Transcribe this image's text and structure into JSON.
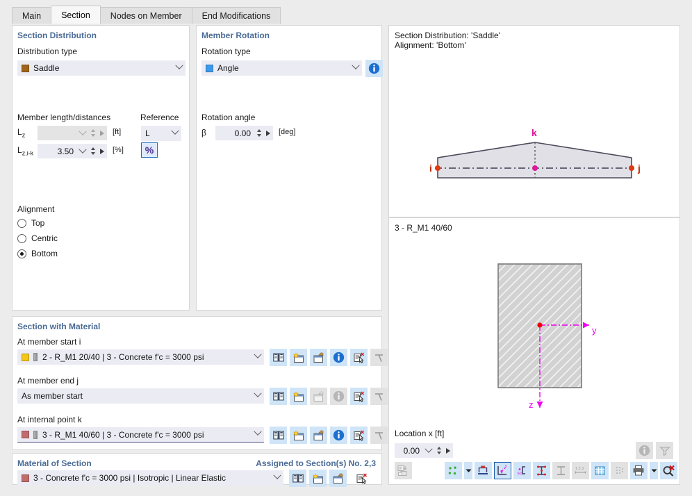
{
  "tabs": [
    {
      "label": "Main",
      "active": false
    },
    {
      "label": "Section",
      "active": true
    },
    {
      "label": "Nodes on Member",
      "active": false
    },
    {
      "label": "End Modifications",
      "active": false
    }
  ],
  "section_distribution": {
    "title": "Section Distribution",
    "distribution_type_label": "Distribution type",
    "distribution_type_value": "Saddle",
    "distribution_type_color": "#a0651a",
    "member_length_label": "Member length/distances",
    "reference_label": "Reference",
    "rows": [
      {
        "symbol": "L",
        "sub": "z",
        "value": "",
        "unit": "[ft]",
        "disabled": true
      },
      {
        "symbol": "L",
        "sub": "z,i-k",
        "value": "3.50",
        "unit": "[%]",
        "disabled": false
      }
    ],
    "reference_value": "L",
    "percent_button_label": "%",
    "alignment_label": "Alignment",
    "alignment_options": [
      {
        "label": "Top",
        "checked": false
      },
      {
        "label": "Centric",
        "checked": false
      },
      {
        "label": "Bottom",
        "checked": true
      }
    ]
  },
  "member_rotation": {
    "title": "Member Rotation",
    "rotation_type_label": "Rotation type",
    "rotation_type_value": "Angle",
    "rotation_type_color": "#3b9aec",
    "rotation_angle_label": "Rotation angle",
    "beta_symbol": "β",
    "beta_value": "0.00",
    "beta_unit": "[deg]"
  },
  "section_with_material": {
    "title": "Section with Material",
    "fields": [
      {
        "label": "At member start i",
        "value": "2 - R_M1 20/40 | 3 - Concrete f'c = 3000 psi",
        "color": "#f5c518",
        "has_swatch": true,
        "underline": false,
        "buttons": [
          "library-icon",
          "new-section-icon",
          "edit-section-icon",
          "info-icon",
          "select-in-model-icon",
          "pick-icon"
        ],
        "button_states": [
          true,
          true,
          true,
          true,
          true,
          false
        ]
      },
      {
        "label": "At member end j",
        "value": "As member start",
        "color": "",
        "has_swatch": false,
        "underline": false,
        "buttons": [
          "library-icon",
          "new-section-icon",
          "edit-section-icon",
          "info-icon",
          "select-in-model-icon",
          "pick-icon"
        ],
        "button_states": [
          true,
          true,
          false,
          false,
          true,
          false
        ]
      },
      {
        "label": "At internal point k",
        "value": "3 - R_M1 40/60 | 3 - Concrete f'c = 3000 psi",
        "color": "#c26d6d",
        "has_swatch": true,
        "underline": true,
        "buttons": [
          "library-icon",
          "new-section-icon",
          "edit-section-icon",
          "info-icon",
          "select-in-model-icon",
          "pick-icon"
        ],
        "button_states": [
          true,
          true,
          true,
          true,
          true,
          false
        ]
      }
    ]
  },
  "material_of_section": {
    "title": "Material of Section",
    "assigned_to": "Assigned to Section(s) No. 2,3",
    "value": "3 - Concrete f'c = 3000 psi | Isotropic | Linear Elastic",
    "color": "#c26d6d",
    "buttons": [
      "library-icon",
      "new-material-icon",
      "edit-material-icon",
      "select-in-model-icon"
    ]
  },
  "preview_top": {
    "line1": "Section Distribution: 'Saddle'",
    "line2": "Alignment: 'Bottom'",
    "node_i": "i",
    "node_j": "j",
    "node_k": "k"
  },
  "preview_bottom": {
    "section_title": "3 - R_M1 40/60",
    "axis_y": "y",
    "axis_z": "z",
    "location_label": "Location x [ft]",
    "location_value": "0.00"
  },
  "bottom_toolbar": {
    "right_buttons": [
      {
        "name": "info-icon",
        "enabled": false
      },
      {
        "name": "filter-icon",
        "enabled": false
      }
    ],
    "left_button": {
      "name": "render-mode-icon",
      "enabled": false
    },
    "buttons": [
      {
        "name": "nodes-display-icon",
        "enabled": true,
        "selected": false,
        "dropdown": true
      },
      {
        "name": "dimensions-icon",
        "enabled": true,
        "selected": false,
        "dropdown": false
      },
      {
        "name": "principal-axes-icon",
        "enabled": true,
        "selected": true,
        "dropdown": false
      },
      {
        "name": "shear-center-icon",
        "enabled": true,
        "selected": false,
        "dropdown": false
      },
      {
        "name": "stress-points-icon",
        "enabled": true,
        "selected": false,
        "dropdown": false
      },
      {
        "name": "section-outline-icon",
        "enabled": false,
        "selected": false,
        "dropdown": false
      },
      {
        "name": "numbering-icon",
        "enabled": false,
        "selected": false,
        "dropdown": false
      },
      {
        "name": "grid-icon",
        "enabled": true,
        "selected": false,
        "dropdown": false
      },
      {
        "name": "mesh-icon",
        "enabled": false,
        "selected": false,
        "dropdown": false
      },
      {
        "name": "print-icon",
        "enabled": true,
        "selected": false,
        "dropdown": true
      },
      {
        "name": "reset-zoom-icon",
        "enabled": true,
        "selected": false,
        "dropdown": false
      }
    ]
  }
}
